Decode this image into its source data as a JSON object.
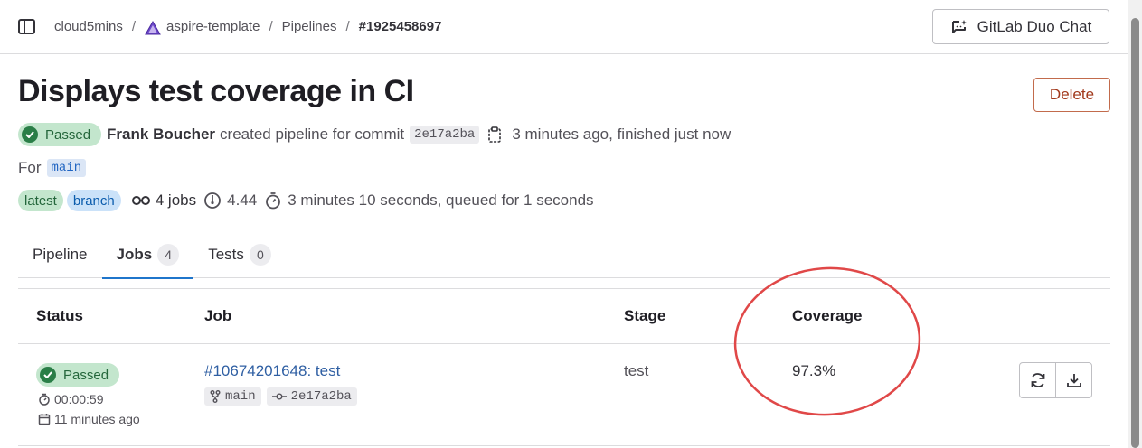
{
  "breadcrumb": {
    "items": [
      "cloud5mins",
      "aspire-template",
      "Pipelines",
      "#1925458697"
    ],
    "separator": "/"
  },
  "header": {
    "duo_chat_label": "GitLab Duo Chat"
  },
  "pipeline": {
    "title": "Displays test coverage in CI",
    "delete_label": "Delete",
    "status": "Passed",
    "author": "Frank Boucher",
    "created_text": "created pipeline for commit",
    "commit_sha": "2e17a2ba",
    "time_text": "3 minutes ago, finished just now",
    "for_label": "For",
    "ref": "main",
    "labels": [
      "latest",
      "branch"
    ],
    "jobs_count": "4 jobs",
    "compute": "4.44",
    "duration_text": "3 minutes 10 seconds, queued for 1 seconds"
  },
  "tabs": [
    {
      "label": "Pipeline",
      "count": null,
      "active": false
    },
    {
      "label": "Jobs",
      "count": "4",
      "active": true
    },
    {
      "label": "Tests",
      "count": "0",
      "active": false
    }
  ],
  "jobs_table": {
    "columns": [
      "Status",
      "Job",
      "Stage",
      "Coverage"
    ],
    "rows": [
      {
        "status": "Passed",
        "duration": "00:00:59",
        "finished": "11 minutes ago",
        "job": "#10674201648: test",
        "ref": "main",
        "sha": "2e17a2ba",
        "stage": "test",
        "coverage": "97.3%"
      }
    ]
  },
  "colors": {
    "success_green": "#2a7e47",
    "link_blue": "#2f5fa3",
    "danger": "#a2391c",
    "annotation_red": "#e04848"
  }
}
